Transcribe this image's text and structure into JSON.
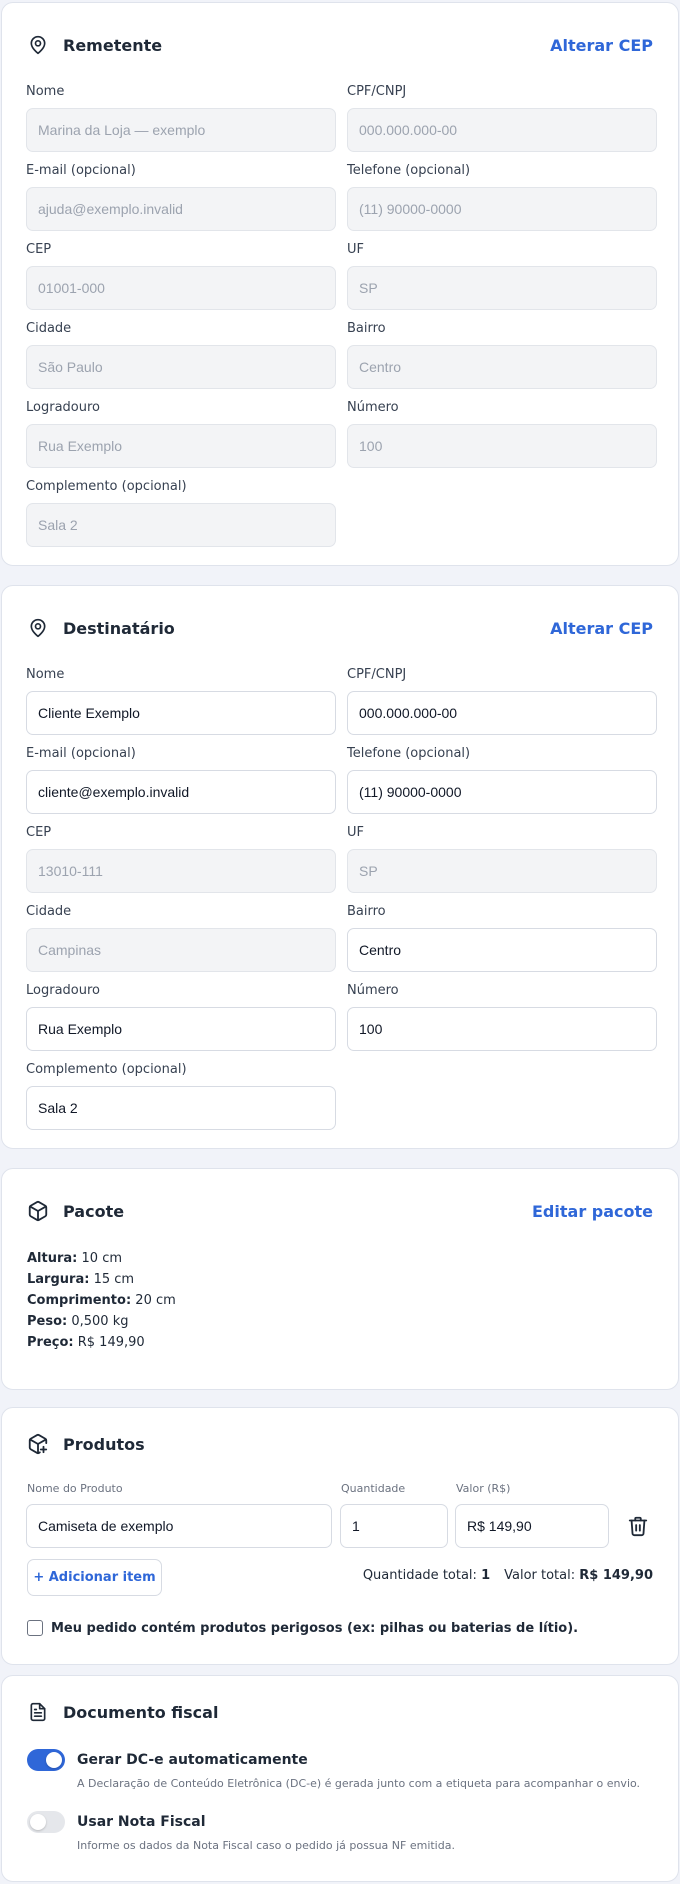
{
  "remetente": {
    "title": "Remetente",
    "action": "Alterar CEP",
    "icon": "map-pin-icon",
    "fields": {
      "nome": {
        "label": "Nome",
        "value": "Marina da Loja — exemplo"
      },
      "doc": {
        "label": "CPF/CNPJ",
        "value": "000.000.000-00"
      },
      "email": {
        "label": "E-mail (opcional)",
        "value": "ajuda@exemplo.invalid"
      },
      "telefone": {
        "label": "Telefone (opcional)",
        "value": "(11) 90000-0000"
      },
      "cep": {
        "label": "CEP",
        "value": "01001-000"
      },
      "uf": {
        "label": "UF",
        "value": "SP"
      },
      "cidade": {
        "label": "Cidade",
        "value": "São Paulo"
      },
      "bairro": {
        "label": "Bairro",
        "value": "Centro"
      },
      "logradouro": {
        "label": "Logradouro",
        "value": "Rua Exemplo"
      },
      "numero": {
        "label": "Número",
        "value": "100"
      },
      "complemento": {
        "label": "Complemento (opcional)",
        "value": "Sala 2"
      }
    }
  },
  "destinatario": {
    "title": "Destinatário",
    "action": "Alterar CEP",
    "icon": "map-pin-icon",
    "fields": {
      "nome": {
        "label": "Nome",
        "value": "Cliente Exemplo"
      },
      "doc": {
        "label": "CPF/CNPJ",
        "value": "000.000.000-00"
      },
      "email": {
        "label": "E-mail (opcional)",
        "value": "cliente@exemplo.invalid"
      },
      "telefone": {
        "label": "Telefone (opcional)",
        "value": "(11) 90000-0000"
      },
      "cep": {
        "label": "CEP",
        "value": "13010-111"
      },
      "uf": {
        "label": "UF",
        "value": "SP"
      },
      "cidade": {
        "label": "Cidade",
        "value": "Campinas"
      },
      "bairro": {
        "label": "Bairro",
        "value": "Centro"
      },
      "logradouro": {
        "label": "Logradouro",
        "value": "Rua Exemplo"
      },
      "numero": {
        "label": "Número",
        "value": "100"
      },
      "complemento": {
        "label": "Complemento (opcional)",
        "value": "Sala 2"
      }
    }
  },
  "pacote": {
    "title": "Pacote",
    "action": "Editar pacote",
    "icon": "box-icon",
    "rows": [
      {
        "label": "Altura:",
        "value": "10 cm"
      },
      {
        "label": "Largura:",
        "value": "15 cm"
      },
      {
        "label": "Comprimento:",
        "value": "20 cm"
      },
      {
        "label": "Peso:",
        "value": "0,500 kg"
      },
      {
        "label": "Preço:",
        "value": "R$ 149,90"
      }
    ]
  },
  "produtos": {
    "title": "Produtos",
    "icon": "box-plus-icon",
    "col_nome": "Nome do Produto",
    "col_qtd": "Quantidade",
    "col_valor": "Valor (R$)",
    "item": {
      "nome": "Camiseta de exemplo",
      "quantidade": "1",
      "valor": "R$ 149,90"
    },
    "add_label": "+ Adicionar item",
    "qtd_total_label": "Quantidade total:",
    "qtd_total": "1",
    "valor_total_label": "Valor total:",
    "valor_total": "R$ 149,90",
    "perigosos_label": "Meu pedido contém produtos perigosos (ex: pilhas ou baterias de lítio)."
  },
  "fiscal": {
    "title": "Documento fiscal",
    "icon": "document-icon",
    "dce": {
      "title": "Gerar DC-e automaticamente",
      "desc": "A Declaração de Conteúdo Eletrônica (DC-e) é gerada junto com a etiqueta para acompanhar o envio.",
      "enabled": true
    },
    "nf": {
      "title": "Usar Nota Fiscal",
      "desc": "Informe os dados da Nota Fiscal caso o pedido já possua NF emitida.",
      "enabled": false
    }
  },
  "colors": {
    "accent": "#2f67d8",
    "background": "#f1f3f9",
    "disabled_bg": "#f3f4f6"
  }
}
